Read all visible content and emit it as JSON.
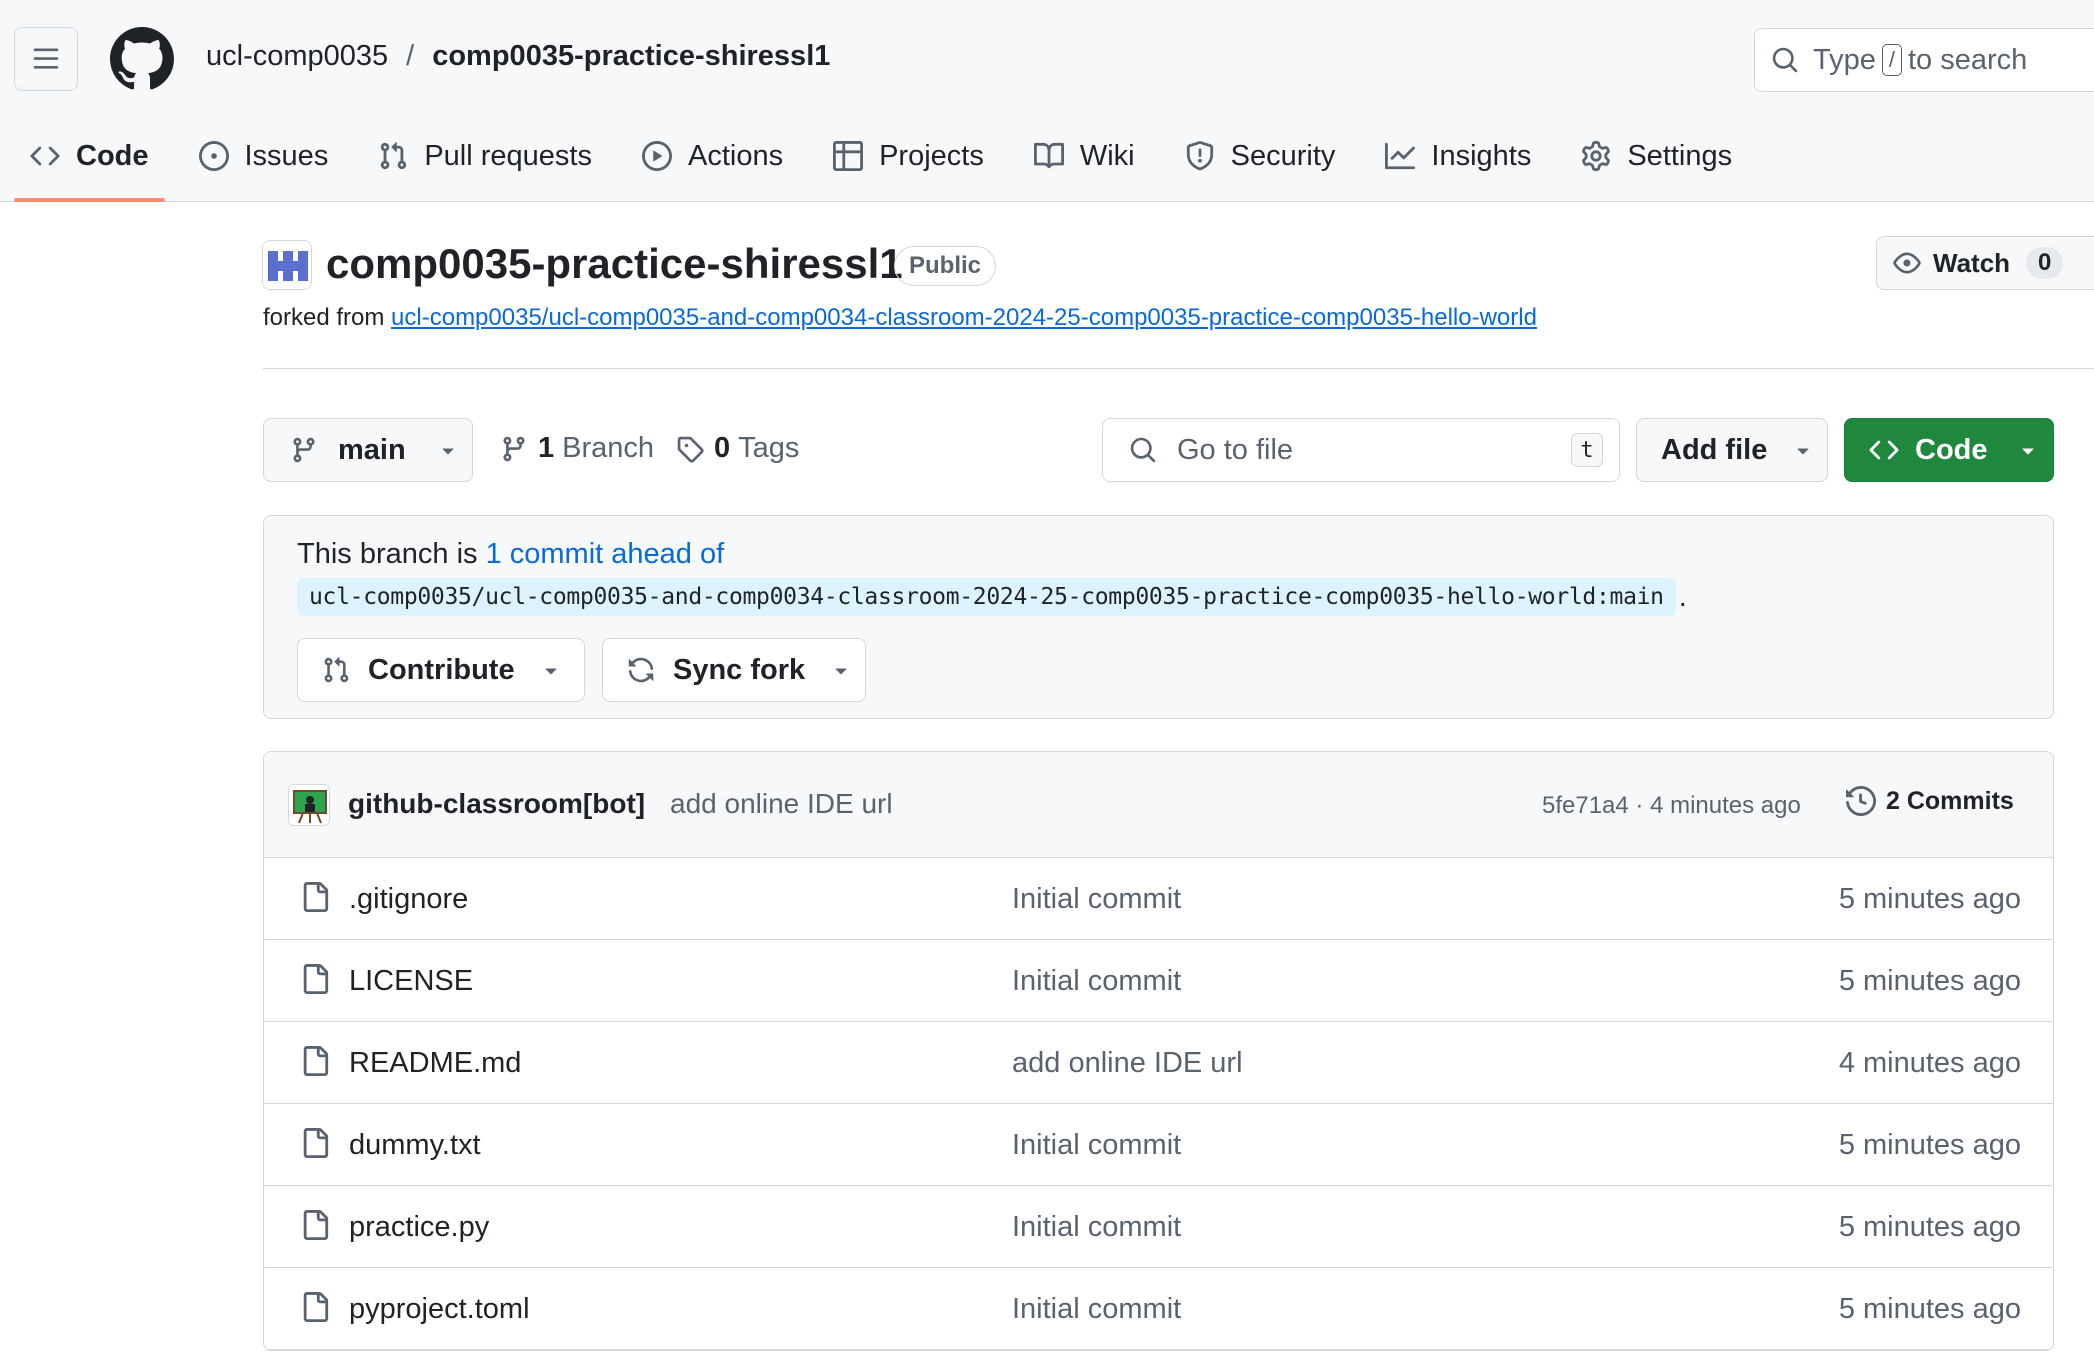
{
  "header": {
    "owner": "ucl-comp0035",
    "separator": "/",
    "repo": "comp0035-practice-shiressl1",
    "search": {
      "prefix": "Type",
      "key": "/",
      "suffix": "to search"
    }
  },
  "tabs": [
    {
      "label": "Code",
      "icon": "code-icon",
      "active": true
    },
    {
      "label": "Issues",
      "icon": "issue-icon"
    },
    {
      "label": "Pull requests",
      "icon": "pull-request-icon"
    },
    {
      "label": "Actions",
      "icon": "play-icon"
    },
    {
      "label": "Projects",
      "icon": "table-icon"
    },
    {
      "label": "Wiki",
      "icon": "book-icon"
    },
    {
      "label": "Security",
      "icon": "shield-icon"
    },
    {
      "label": "Insights",
      "icon": "graph-icon"
    },
    {
      "label": "Settings",
      "icon": "gear-icon"
    }
  ],
  "repo": {
    "name": "comp0035-practice-shiressl1",
    "visibility": "Public",
    "forked_prefix": "forked from",
    "forked_from": "ucl-comp0035/ucl-comp0035-and-comp0034-classroom-2024-25-comp0035-practice-comp0035-hello-world",
    "watch_label": "Watch",
    "watch_count": "0"
  },
  "toolbar": {
    "branch": "main",
    "branch_count": "1",
    "branch_label": "Branch",
    "tag_count": "0",
    "tag_label": "Tags",
    "goto_placeholder": "Go to file",
    "goto_key": "t",
    "add_file": "Add file",
    "code": "Code"
  },
  "ahead": {
    "prefix": "This branch is",
    "link": "1 commit ahead of",
    "ref": "ucl-comp0035/ucl-comp0035-and-comp0034-classroom-2024-25-comp0035-practice-comp0035-hello-world:main",
    "period": ".",
    "contribute": "Contribute",
    "sync_fork": "Sync fork"
  },
  "latest_commit": {
    "author": "github-classroom[bot]",
    "message": "add online IDE url",
    "meta": "5fe71a4 · 4 minutes ago",
    "commits_label": "2 Commits"
  },
  "files": [
    {
      "name": ".gitignore",
      "message": "Initial commit",
      "time": "5 minutes ago"
    },
    {
      "name": "LICENSE",
      "message": "Initial commit",
      "time": "5 minutes ago"
    },
    {
      "name": "README.md",
      "message": "add online IDE url",
      "time": "4 minutes ago"
    },
    {
      "name": "dummy.txt",
      "message": "Initial commit",
      "time": "5 minutes ago"
    },
    {
      "name": "practice.py",
      "message": "Initial commit",
      "time": "5 minutes ago"
    },
    {
      "name": "pyproject.toml",
      "message": "Initial commit",
      "time": "5 minutes ago"
    }
  ],
  "colors": {
    "accent": "#0969da",
    "primary_button": "#1f883d",
    "tab_underline": "#fd8c73"
  }
}
